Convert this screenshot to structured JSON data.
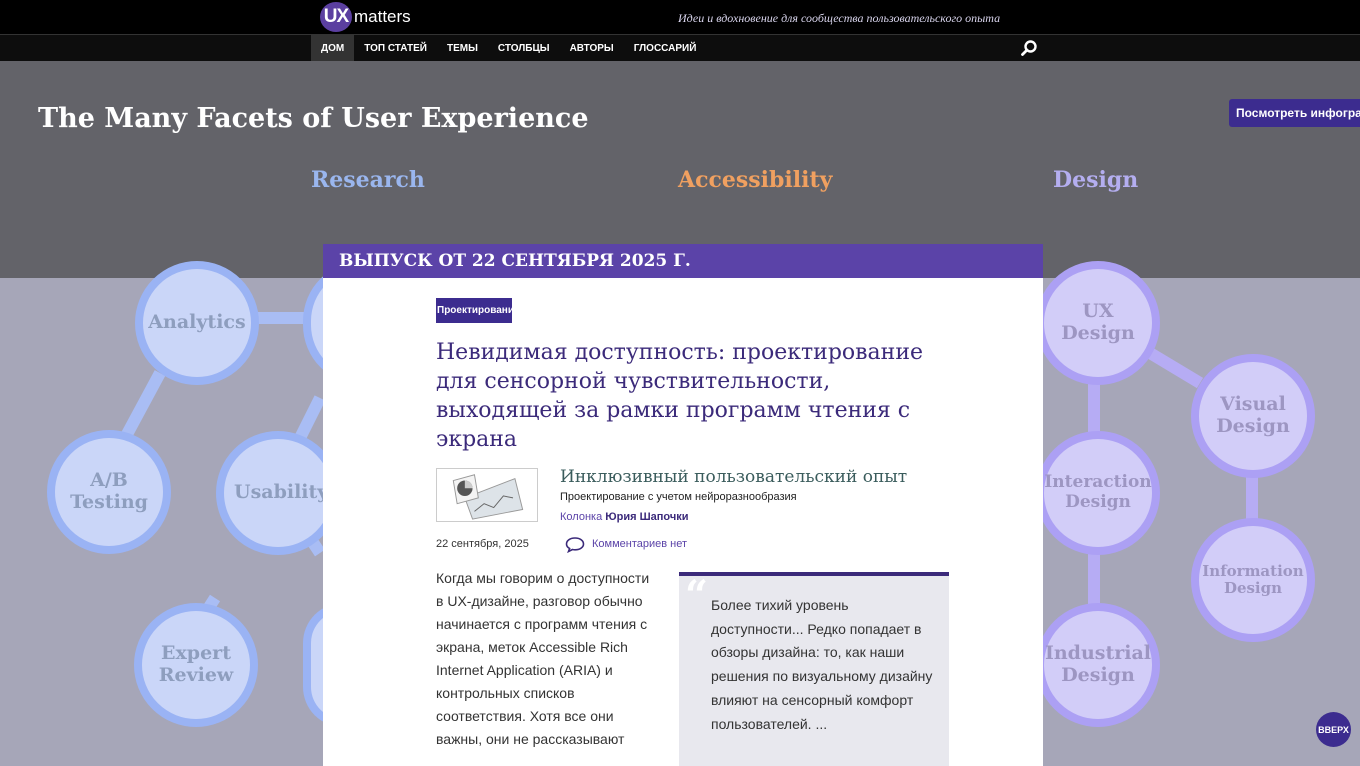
{
  "header": {
    "logo_ux": "UX",
    "logo_matters": "matters",
    "tagline": "Идеи и вдохновение для сообщества пользовательского опыта"
  },
  "nav": {
    "items": [
      {
        "label": "ДОМ",
        "active": true
      },
      {
        "label": "ТОП СТАТЕЙ"
      },
      {
        "label": "ТЕМЫ"
      },
      {
        "label": "СТОЛБЦЫ"
      },
      {
        "label": "АВТОРЫ"
      },
      {
        "label": "ГЛОССАРИЙ"
      }
    ],
    "search_icon": "search-icon"
  },
  "hero": {
    "title": "The Many Facets of User Experience",
    "button": "Посмотреть инфографику",
    "facets": {
      "research": "Research",
      "accessibility": "Accessibility",
      "design": "Design"
    }
  },
  "diagram": {
    "left": {
      "analytics": "Analytics",
      "ab_line1": "A/B",
      "ab_line2": "Testing",
      "usability": "Usability",
      "expert_line1": "Expert",
      "expert_line2": "Review"
    },
    "right": {
      "ux_line1": "UX",
      "ux_line2": "Design",
      "visual_line1": "Visual",
      "visual_line2": "Design",
      "interaction_line1": "Interaction",
      "interaction_line2": "Design",
      "information_line1": "Information",
      "information_line2": "Design",
      "industrial_line1": "Industrial",
      "industrial_line2": "Design"
    },
    "colors": {
      "blue": "#9ab3f4",
      "violet": "#aca0f4"
    }
  },
  "issue": {
    "header": "ВЫПУСК ОТ 22 СЕНТЯБРЯ 2025 Г."
  },
  "article": {
    "tag": "Проектирование",
    "title": "Невидимая доступность: проектирование для сенсорной чувствительности, выходящей за рамки программ чтения с экрана",
    "column_title": "Инклюзивный пользовательский опыт",
    "column_subtitle": "Проектирование с учетом нейроразнообразия",
    "column_prefix": "Колонка",
    "column_author": "Юрия Шапочки",
    "date": "22 сентября, 2025",
    "comments": "Комментариев нет",
    "body": "Когда мы говорим о доступности в UX-дизайне, разговор обычно начинается с программ чтения с экрана, меток Accessible Rich Internet Application (ARIA) и контрольных списков соответствия. Хотя все они важны, они не рассказывают",
    "quote": "Более тихий уровень доступности... Редко попадает в обзоры дизайна: то, как наши решения по визуальному дизайну влияют на сенсорный комфорт пользователей. ..."
  },
  "back_to_top": "ВВЕРХ"
}
